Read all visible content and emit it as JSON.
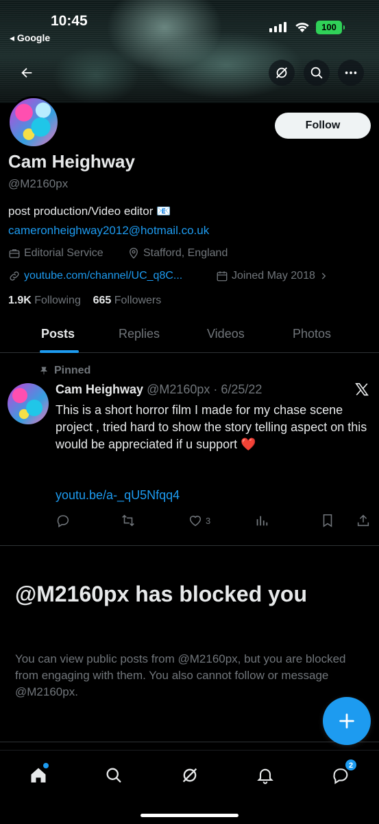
{
  "status_bar": {
    "time": "10:45",
    "back_app": "◂ Google",
    "battery": "100"
  },
  "profile": {
    "name": "Cam Heighway",
    "handle": "@M2160px",
    "bio": "post production/Video editor 📧",
    "email": "cameronheighway2012@hotmail.co.uk",
    "category": "Editorial Service",
    "location": "Stafford, England",
    "website": "youtube.com/channel/UC_q8C...",
    "joined": "Joined May 2018",
    "following_count": "1.9K",
    "following_label": "Following",
    "followers_count": "665",
    "followers_label": "Followers",
    "follow_button": "Follow"
  },
  "tabs": [
    {
      "label": "Posts"
    },
    {
      "label": "Replies"
    },
    {
      "label": "Videos"
    },
    {
      "label": "Photos"
    }
  ],
  "pinned_post": {
    "pinned_label": "Pinned",
    "author": "Cam Heighway",
    "handle_date": "@M2160px · 6/25/22",
    "text": "This is a short horror film I made for my chase scene project , tried hard to show the story telling aspect on this would be appreciated if u support ❤️",
    "link": "youtu.be/a-_qU5Nfqq4",
    "likes": "3"
  },
  "blocked": {
    "title": "@M2160px has blocked you",
    "description": "You can view public posts from @M2160px, but you are blocked from engaging with them. You also cannot follow or message @M2160px."
  },
  "bottom_nav": {
    "messages_badge": "2"
  },
  "colors": {
    "accent": "#1d9bf0",
    "background": "#000000",
    "text_primary": "#e7e9ea",
    "text_secondary": "#71767b",
    "battery": "#30d158"
  }
}
